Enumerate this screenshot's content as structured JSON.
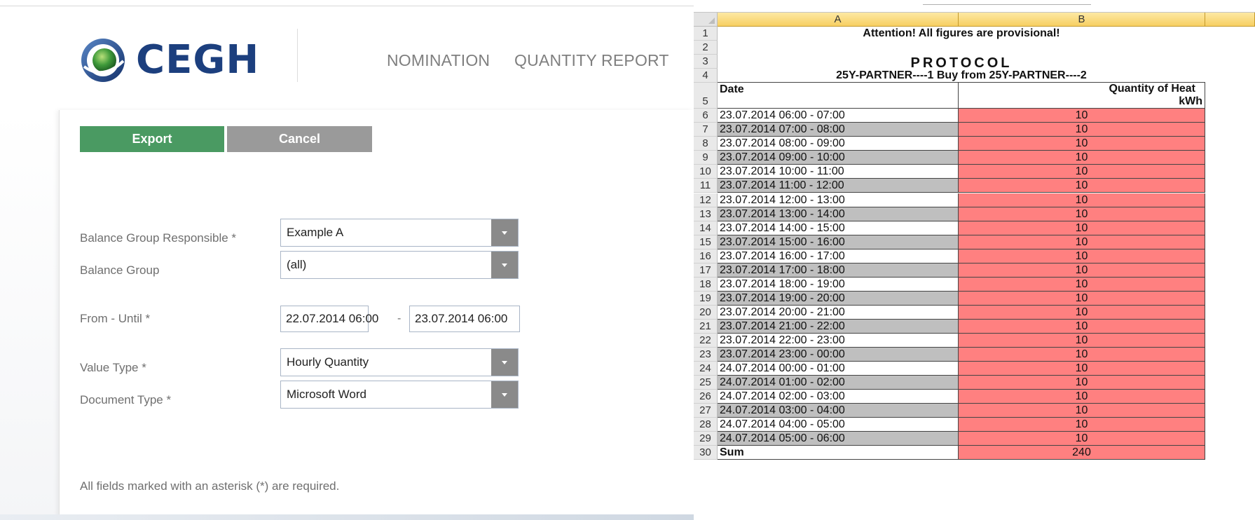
{
  "header": {
    "logo_text": "CEGH",
    "nav": [
      "NOMINATION",
      "QUANTITY REPORT"
    ]
  },
  "toolbar": {
    "export_label": "Export",
    "cancel_label": "Cancel"
  },
  "form": {
    "balance_group_responsible": {
      "label": "Balance Group Responsible *",
      "value": "Example A"
    },
    "balance_group": {
      "label": "Balance Group",
      "value": "(all)"
    },
    "from_until": {
      "label": "From - Until *",
      "from": "22.07.2014 06:00",
      "separator": "-",
      "until": "23.07.2014 06:00"
    },
    "value_type": {
      "label": "Value Type *",
      "value": "Hourly Quantity"
    },
    "document_type": {
      "label": "Document Type *",
      "value": "Microsoft Word"
    },
    "required_note": "All fields marked with an asterisk (*) are required."
  },
  "colors": {
    "export_green": "#4a9a62",
    "cancel_grey": "#9a9a9a",
    "logo_blue": "#1c3f7e",
    "cell_red": "#ff8080",
    "cell_grey": "#bfbfbf",
    "col_header": "#f7cf62"
  },
  "spreadsheet": {
    "columns": [
      "A",
      "B"
    ],
    "header_rows": [
      {
        "row": "1",
        "text": "Attention! All figures are provisional!"
      },
      {
        "row": "2",
        "text": ""
      },
      {
        "row": "3",
        "text": "PROTOCOL"
      },
      {
        "row": "4",
        "text": "25Y-PARTNER----1 Buy from 25Y-PARTNER----2"
      }
    ],
    "row5": {
      "row": "5",
      "a": "Date",
      "b_line1": "Quantity of Heat",
      "b_line2": "kWh"
    },
    "rows": [
      {
        "row": "6",
        "date": "23.07.2014 06:00 - 07:00",
        "qty": "10"
      },
      {
        "row": "7",
        "date": "23.07.2014 07:00 - 08:00",
        "qty": "10"
      },
      {
        "row": "8",
        "date": "23.07.2014 08:00 - 09:00",
        "qty": "10"
      },
      {
        "row": "9",
        "date": "23.07.2014 09:00 - 10:00",
        "qty": "10"
      },
      {
        "row": "10",
        "date": "23.07.2014 10:00 - 11:00",
        "qty": "10"
      },
      {
        "row": "11",
        "date": "23.07.2014 11:00 - 12:00",
        "qty": "10"
      },
      {
        "row": "12",
        "date": "23.07.2014 12:00 - 13:00",
        "qty": "10"
      },
      {
        "row": "13",
        "date": "23.07.2014 13:00 - 14:00",
        "qty": "10"
      },
      {
        "row": "14",
        "date": "23.07.2014 14:00 - 15:00",
        "qty": "10"
      },
      {
        "row": "15",
        "date": "23.07.2014 15:00 - 16:00",
        "qty": "10"
      },
      {
        "row": "16",
        "date": "23.07.2014 16:00 - 17:00",
        "qty": "10"
      },
      {
        "row": "17",
        "date": "23.07.2014 17:00 - 18:00",
        "qty": "10"
      },
      {
        "row": "18",
        "date": "23.07.2014 18:00 - 19:00",
        "qty": "10"
      },
      {
        "row": "19",
        "date": "23.07.2014 19:00 - 20:00",
        "qty": "10"
      },
      {
        "row": "20",
        "date": "23.07.2014 20:00 - 21:00",
        "qty": "10"
      },
      {
        "row": "21",
        "date": "23.07.2014 21:00 - 22:00",
        "qty": "10"
      },
      {
        "row": "22",
        "date": "23.07.2014 22:00 - 23:00",
        "qty": "10"
      },
      {
        "row": "23",
        "date": "23.07.2014 23:00 - 00:00",
        "qty": "10"
      },
      {
        "row": "24",
        "date": "24.07.2014 00:00 - 01:00",
        "qty": "10"
      },
      {
        "row": "25",
        "date": "24.07.2014 01:00 - 02:00",
        "qty": "10"
      },
      {
        "row": "26",
        "date": "24.07.2014 02:00 - 03:00",
        "qty": "10"
      },
      {
        "row": "27",
        "date": "24.07.2014 03:00 - 04:00",
        "qty": "10"
      },
      {
        "row": "28",
        "date": "24.07.2014 04:00 - 05:00",
        "qty": "10"
      },
      {
        "row": "29",
        "date": "24.07.2014 05:00 - 06:00",
        "qty": "10"
      }
    ],
    "sum_row": {
      "row": "30",
      "label": "Sum",
      "qty": "240"
    }
  }
}
